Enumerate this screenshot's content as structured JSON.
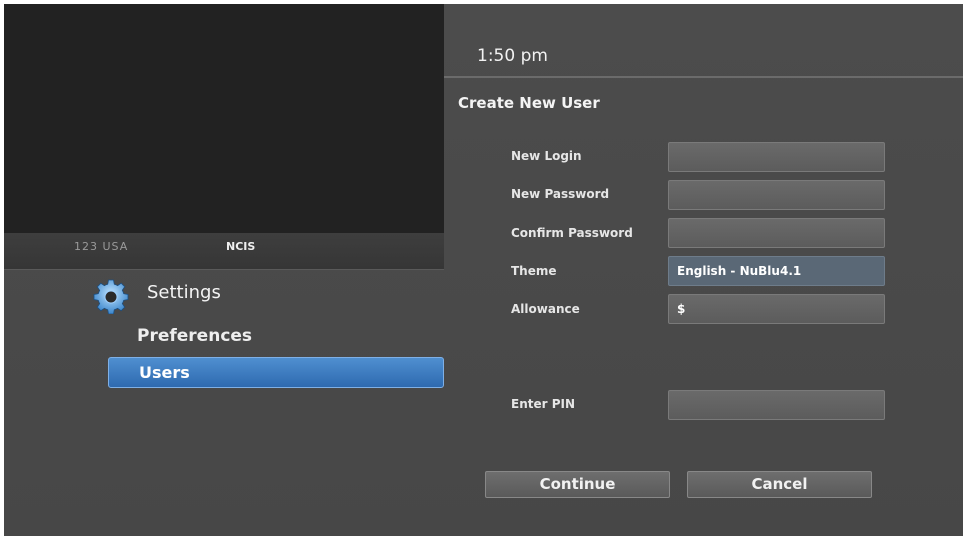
{
  "video": {
    "channel_number": "123 USA",
    "program": "NCIS"
  },
  "clock": "1:50 pm",
  "menu": {
    "title": "Settings",
    "icon": "gear-icon",
    "items": [
      {
        "label": "Preferences",
        "selected": false
      },
      {
        "label": "Users",
        "selected": true
      }
    ]
  },
  "form": {
    "title": "Create New User",
    "fields": {
      "new_login": {
        "label": "New Login",
        "value": ""
      },
      "new_password": {
        "label": "New Password",
        "value": ""
      },
      "confirm_password": {
        "label": "Confirm Password",
        "value": ""
      },
      "theme": {
        "label": "Theme",
        "value": "English - NuBlu4.1"
      },
      "allowance": {
        "label": "Allowance",
        "value": "$"
      },
      "enter_pin": {
        "label": "Enter PIN",
        "value": ""
      }
    },
    "continue_label": "Continue",
    "cancel_label": "Cancel"
  },
  "colors": {
    "background": "#4a4a4a",
    "selected_item": "#3a7cc4",
    "video_area": "#222222"
  }
}
